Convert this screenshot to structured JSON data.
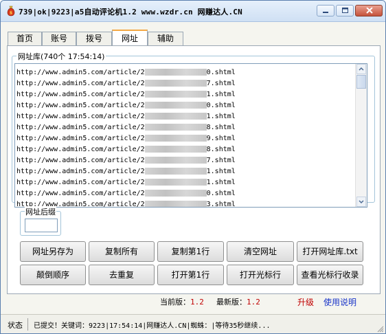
{
  "window": {
    "title": "739|ok|9223|a5自动评论机1.2 www.wzdr.cn 网赚达人.CN"
  },
  "tabs": [
    {
      "label": "首页"
    },
    {
      "label": "账号"
    },
    {
      "label": "拨号"
    },
    {
      "label": "网址"
    },
    {
      "label": "辅助"
    }
  ],
  "active_tab": "网址",
  "url_library": {
    "label": "网址库(740个 17:54:14)",
    "rows": [
      {
        "prefix": "http://www.admin5.com/article/2",
        "suffix": "0.shtml"
      },
      {
        "prefix": "http://www.admin5.com/article/2",
        "suffix": "7.shtml"
      },
      {
        "prefix": "http://www.admin5.com/article/2",
        "suffix": "1.shtml"
      },
      {
        "prefix": "http://www.admin5.com/article/2",
        "suffix": "0.shtml"
      },
      {
        "prefix": "http://www.admin5.com/article/2",
        "suffix": "1.shtml"
      },
      {
        "prefix": "http://www.admin5.com/article/2",
        "suffix": "8.shtml"
      },
      {
        "prefix": "http://www.admin5.com/article/2",
        "suffix": "9.shtml"
      },
      {
        "prefix": "http://www.admin5.com/article/2",
        "suffix": "8.shtml"
      },
      {
        "prefix": "http://www.admin5.com/article/2",
        "suffix": "7.shtml"
      },
      {
        "prefix": "http://www.admin5.com/article/2",
        "suffix": "1.shtml"
      },
      {
        "prefix": "http://www.admin5.com/article/2",
        "suffix": "1.shtml"
      },
      {
        "prefix": "http://www.admin5.com/article/2",
        "suffix": "0.shtml"
      },
      {
        "prefix": "http://www.admin5.com/article/2",
        "suffix": "3.shtml"
      }
    ]
  },
  "url_suffix": {
    "label": "网址后缀",
    "value": ""
  },
  "buttons_row1": [
    {
      "label": "网址另存为"
    },
    {
      "label": "复制所有"
    },
    {
      "label": "复制第1行"
    },
    {
      "label": "清空网址"
    },
    {
      "label": "打开网址库.txt"
    }
  ],
  "buttons_row2": [
    {
      "label": "颠倒顺序"
    },
    {
      "label": "去重复"
    },
    {
      "label": "打开第1行"
    },
    {
      "label": "打开光标行"
    },
    {
      "label": "查看光标行收录"
    }
  ],
  "version": {
    "current_label": "当前版：",
    "current_value": "1.2",
    "latest_label": "最新版：",
    "latest_value": "1.2",
    "upgrade_label": "升级",
    "help_label": "使用说明"
  },
  "status": {
    "label": "状态",
    "text": "已提交！关键词：9223|17:54:14|网赚达人.CN|蜘蛛：|等待35秒继续..."
  },
  "colors": {
    "accent_tab": "#f3a844",
    "version_number": "#c00000",
    "upgrade_link": "#c00000",
    "help_link": "#1a35c8"
  }
}
